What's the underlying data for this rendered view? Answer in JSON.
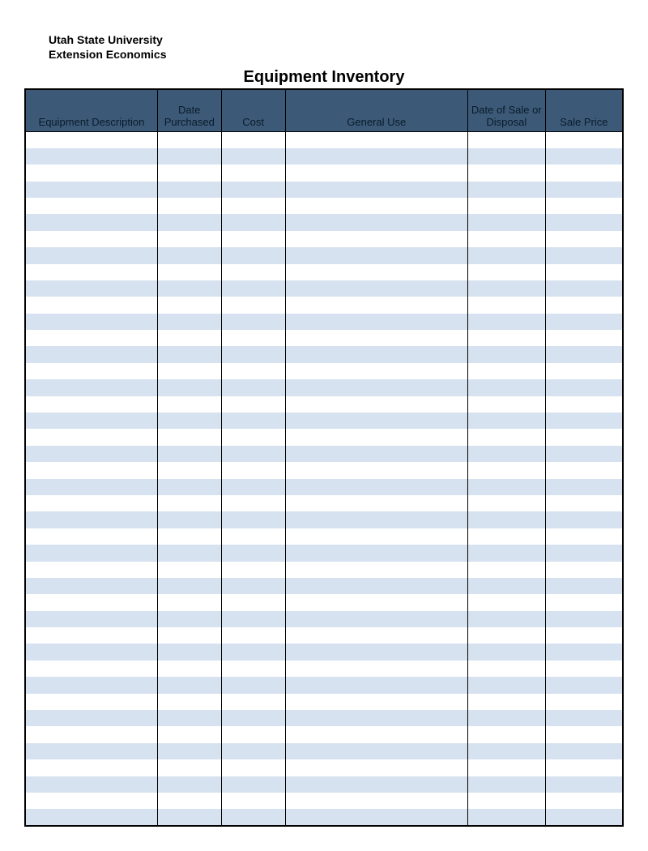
{
  "header": {
    "org_line1": "Utah State University",
    "org_line2": "Extension Economics"
  },
  "title": "Equipment Inventory",
  "columns": [
    "Equipment Description",
    "Date Purchased",
    "Cost",
    "General Use",
    "Date of Sale or Disposal",
    "Sale Price"
  ],
  "row_count": 42,
  "colors": {
    "header_bg": "#3c5a78",
    "band_bg": "#d6e2ef"
  }
}
